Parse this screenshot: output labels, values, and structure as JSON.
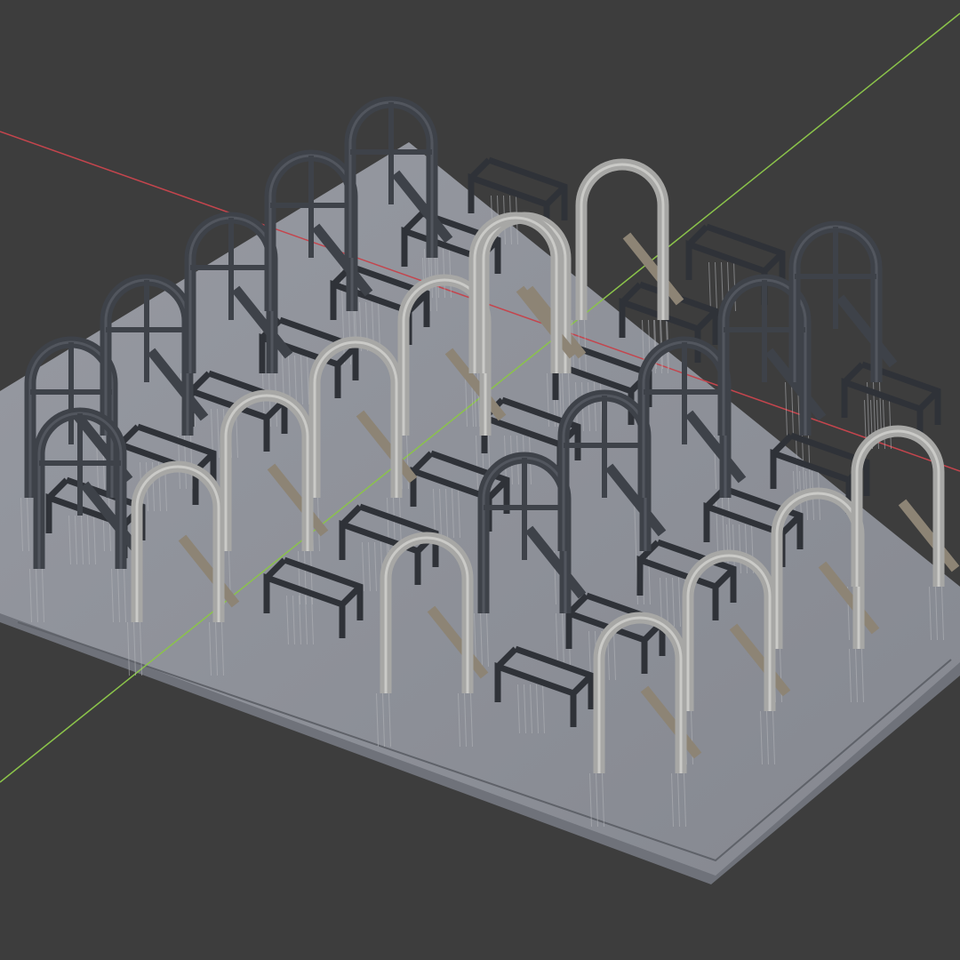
{
  "viewport": {
    "background_color": "#3d3d3d",
    "axis_x_color": "#c4454d",
    "axis_y_color": "#8bc34a"
  },
  "build_plate": {
    "top_color": "#8c8f97",
    "edge_color": "#6f727a",
    "rim_color": "#5f6269"
  },
  "parts": {
    "dark_arch_color": "#3e4249",
    "dark_arch_highlight": "#5b6068",
    "light_arch_color": "#a7a7a5",
    "light_arch_highlight": "#d9d9d6",
    "tan_leg_color": "#8d8475",
    "bench_color": "#2f3238",
    "support_color": "#b5b7bb",
    "dark_arch_count": 11,
    "light_arch_count": 12,
    "bench_count": 20
  }
}
